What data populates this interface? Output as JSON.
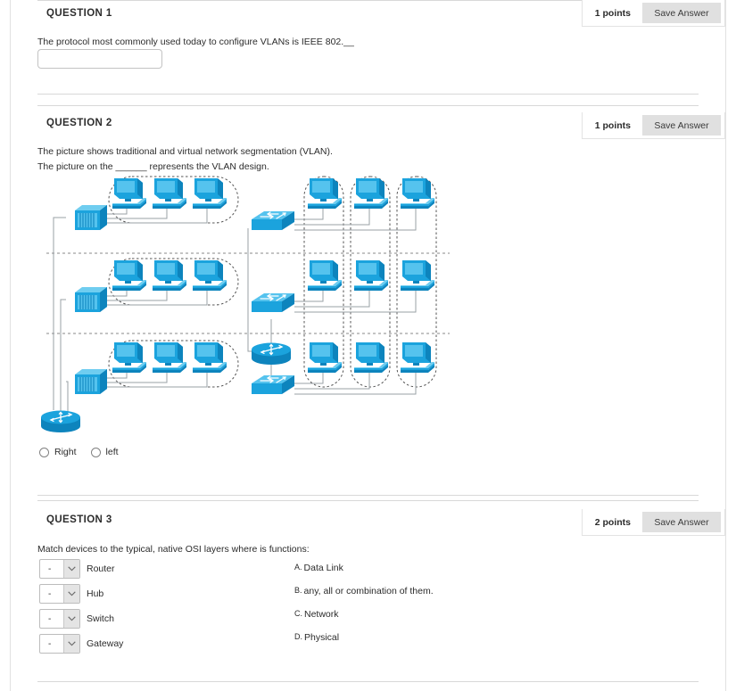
{
  "questions": [
    {
      "id": "q1",
      "title": "QUESTION 1",
      "points": "1 points",
      "save_label": "Save Answer",
      "prompt": "The protocol most commonly used today to configure VLANs is IEEE 802.__",
      "answer_value": "",
      "answer_placeholder": ""
    },
    {
      "id": "q2",
      "title": "QUESTION 2",
      "points": "1 points",
      "save_label": "Save Answer",
      "prompt_line1": "The picture shows traditional and virtual network segmentation (VLAN).",
      "prompt_line2": "The picture on the ______ represents the VLAN design.",
      "options": [
        {
          "label": "Right",
          "selected": false
        },
        {
          "label": "left",
          "selected": false
        }
      ]
    },
    {
      "id": "q3",
      "title": "QUESTION 3",
      "points": "2 points",
      "save_label": "Save Answer",
      "prompt": "Match devices to the typical, native OSI layers where is functions:",
      "match_items": [
        {
          "label": "Router",
          "selected": "-"
        },
        {
          "label": "Hub",
          "selected": "-"
        },
        {
          "label": "Switch",
          "selected": "-"
        },
        {
          "label": "Gateway",
          "selected": "-"
        }
      ],
      "answer_choices": [
        {
          "letter": "A.",
          "text": "Data Link"
        },
        {
          "letter": "B.",
          "text": "any, all or combination of them."
        },
        {
          "letter": "C.",
          "text": "Network"
        },
        {
          "letter": "D.",
          "text": "Physical"
        }
      ]
    }
  ],
  "diagram": {
    "alt": "Traditional network segmentation on the left versus VLAN segmentation on the right",
    "device_color": "#1ba3dd",
    "device_color_dark": "#0d84bd",
    "device_color_light": "#6fcdf0",
    "line_color": "#9aa0a6",
    "dash_color": "#777777"
  },
  "colors": {
    "rule": "#d8d8d8",
    "save_button_bg": "#e0e0e0",
    "text": "#2b2b2b",
    "accent_blue": "#1ba3dd"
  }
}
